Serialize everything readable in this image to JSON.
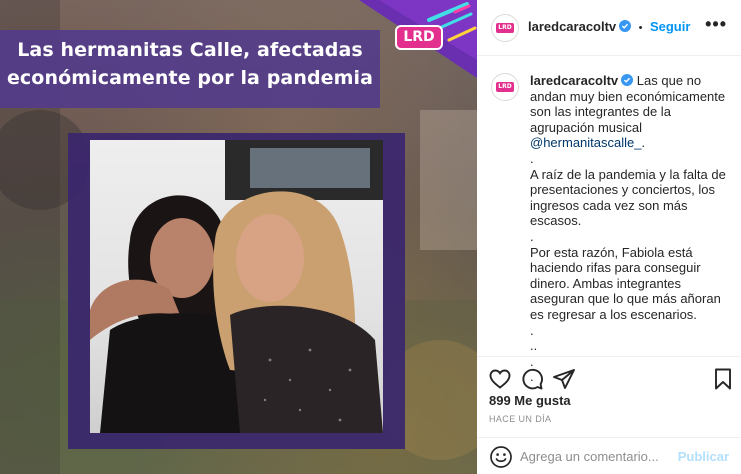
{
  "media": {
    "headline": "Las hermanitas Calle, afectadas económicamente por la pandemia",
    "logo_text": "LRD"
  },
  "post": {
    "avatar_text": "LRD",
    "username": "laredcaracoltv",
    "separator": "•",
    "follow_label": "Seguir",
    "more_label": "•••",
    "caption": {
      "username": "laredcaracoltv",
      "line1": "Las que no andan muy bien económicamente son las integrantes de la agrupación musical",
      "mention": "@hermanitascalle_",
      "mention_suffix": ".",
      "dot1": ".",
      "para2": "A raíz de la pandemia y la falta de presentaciones y conciertos, los ingresos cada vez son más escasos.",
      "dot2": ".",
      "para3": "Por esta razón, Fabiola está haciendo rifas para conseguir dinero. Ambas integrantes aseguran que lo que más añoran es regresar a los escenarios.",
      "dot3": ".",
      "dot4": "..",
      "dot5": ".",
      "dot6": "."
    },
    "likes": "899 Me gusta",
    "time": "HACE UN DÍA",
    "comment_placeholder": "Agrega un comentario...",
    "publish_label": "Publicar",
    "colors": {
      "accent": "#0095f6",
      "brand": "#e3308f",
      "band": "#523a8c"
    }
  }
}
